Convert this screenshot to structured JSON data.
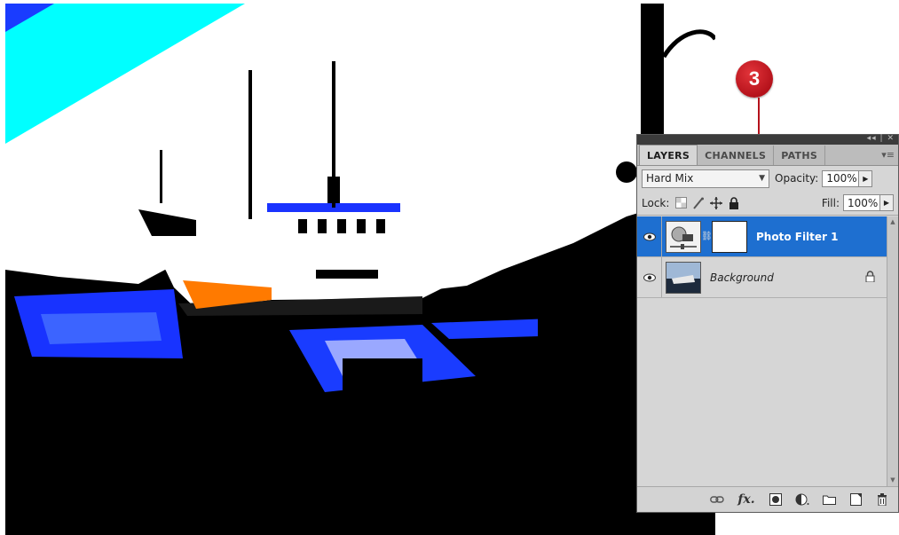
{
  "callout": {
    "number": "3"
  },
  "layers_panel": {
    "tabs": [
      {
        "label": "LAYERS",
        "active": true
      },
      {
        "label": "CHANNELS",
        "active": false
      },
      {
        "label": "PATHS",
        "active": false
      }
    ],
    "blend_mode": "Hard Mix",
    "opacity_label": "Opacity:",
    "opacity_value": "100%",
    "lock_label": "Lock:",
    "fill_label": "Fill:",
    "fill_value": "100%",
    "layers": [
      {
        "name": "Photo Filter 1",
        "selected": true,
        "visible": true,
        "type": "adjustment"
      },
      {
        "name": "Background",
        "selected": false,
        "visible": true,
        "type": "image",
        "locked": true
      }
    ],
    "bottom_icons": [
      "link-layers-icon",
      "fx-icon",
      "add-mask-icon",
      "adjustment-layer-icon",
      "new-group-icon",
      "new-layer-icon",
      "trash-icon"
    ]
  },
  "colors": {
    "selection": "#1e6fd0",
    "callout": "#b5121b",
    "sky_cyan": "#00ffff",
    "water_blue": "#1a3cff"
  }
}
